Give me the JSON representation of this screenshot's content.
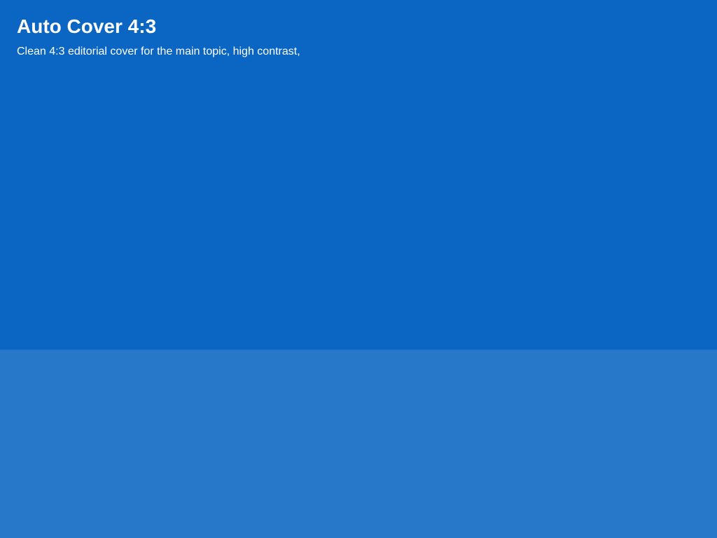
{
  "cover": {
    "title": "Auto Cover 4:3",
    "subtitle": "Clean 4:3 editorial cover for the main topic, high contrast,"
  },
  "colors": {
    "top_panel": "#0a66c2",
    "bottom_panel": "#2878ca",
    "text": "#ffffff"
  }
}
